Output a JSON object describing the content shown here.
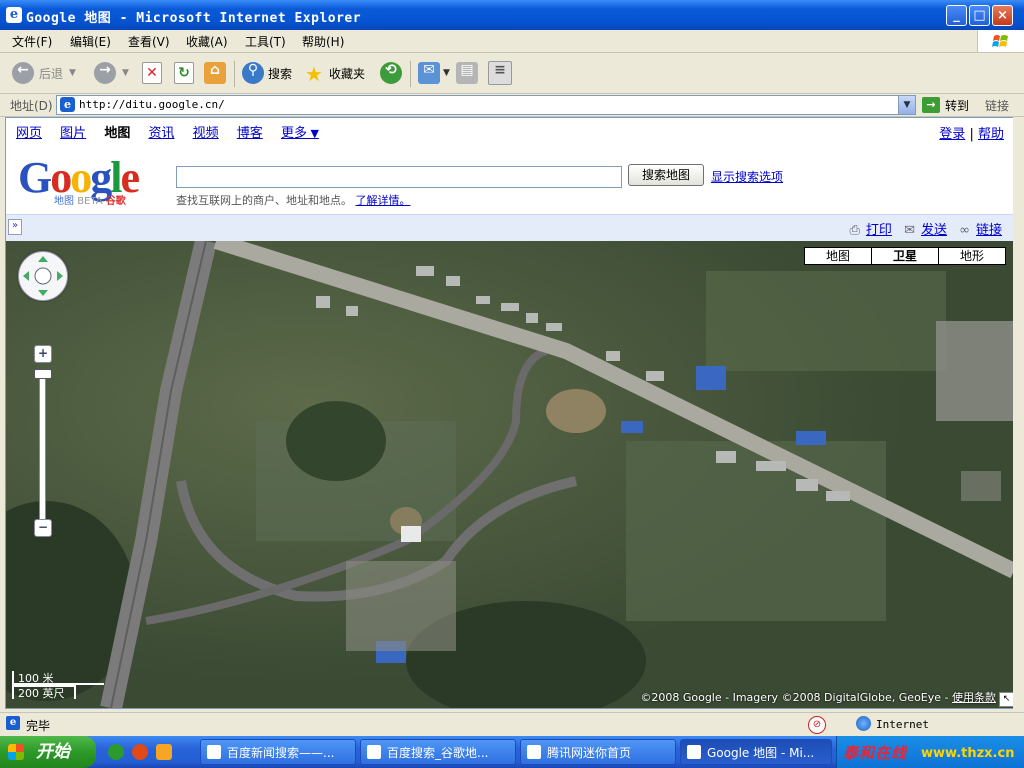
{
  "window": {
    "title": "Google 地图 - Microsoft Internet Explorer",
    "minimize": "_",
    "maximize": "□",
    "close": "×"
  },
  "menu": [
    "文件(F)",
    "编辑(E)",
    "查看(V)",
    "收藏(A)",
    "工具(T)",
    "帮助(H)"
  ],
  "toolbar": {
    "back": "后退",
    "search": "搜索",
    "favorites": "收藏夹"
  },
  "address": {
    "label": "地址(D)",
    "url": "http://ditu.google.cn/",
    "go": "转到",
    "links": "链接"
  },
  "google_nav": {
    "items": [
      "网页",
      "图片",
      "地图",
      "资讯",
      "视频",
      "博客",
      "更多"
    ],
    "current": "地图",
    "login": "登录",
    "separator": "|",
    "help": "帮助"
  },
  "logo": {
    "text": "Google",
    "sub_map": "地图",
    "sub_beta": "BETA",
    "sub_cn": "谷歌"
  },
  "search": {
    "value": "",
    "button": "搜索地图",
    "options": "显示搜索选项",
    "hint": "查找互联网上的商户、地址和地点。",
    "learn_more": "了解详情。"
  },
  "map_links": {
    "print": "打印",
    "send": "发送",
    "link": "链接",
    "collapse": "»"
  },
  "map_types": [
    {
      "label": "地图",
      "selected": false
    },
    {
      "label": "卫星",
      "selected": true
    },
    {
      "label": "地形",
      "selected": false
    }
  ],
  "zoom": {
    "in": "+",
    "out": "−"
  },
  "scale": {
    "metric": "100 米",
    "imperial": "200 英尺"
  },
  "copyright": {
    "text": "©2008 Google - Imagery ©2008 DigitalGlobe, GeoEye - ",
    "terms": "使用条款"
  },
  "status": {
    "text": "完毕",
    "zone": "Internet"
  },
  "taskbar": {
    "start": "开始",
    "tasks": [
      {
        "label": "百度新闻搜索——...",
        "active": false
      },
      {
        "label": "百度搜索_谷歌地...",
        "active": false
      },
      {
        "label": "腾讯网迷你首页",
        "active": false
      },
      {
        "label": "Google 地图 - Mi...",
        "active": true
      }
    ],
    "tray_text": "泰和在线",
    "tray_site": "www.thzx.cn"
  }
}
